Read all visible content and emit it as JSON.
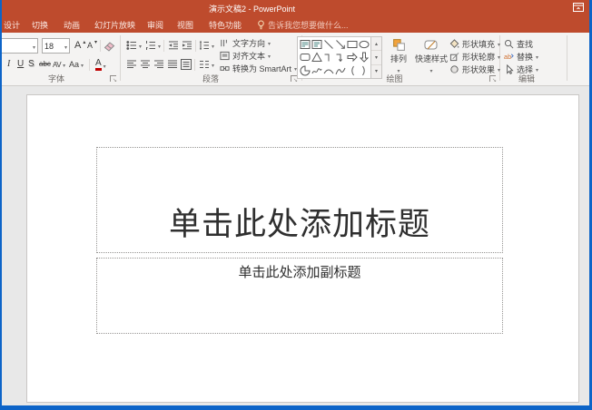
{
  "window": {
    "title": "演示文稿2 - PowerPoint"
  },
  "tabs": {
    "design": "设计",
    "transitions": "切换",
    "animations": "动画",
    "slideshow": "幻灯片放映",
    "review": "审阅",
    "view": "视图",
    "special_features": "特色功能",
    "tell_me": "告诉我您想要做什么..."
  },
  "font_group": {
    "label": "字体",
    "font_size": "18",
    "italic": "I",
    "underline": "U",
    "text_shadow": "S",
    "strikethrough": "abc",
    "char_spacing": "AV",
    "change_case": "Aa",
    "font_color": "A",
    "grow_font": "A",
    "shrink_font": "A"
  },
  "paragraph_group": {
    "label": "段落",
    "text_direction": "文字方向",
    "align_text": "对齐文本",
    "convert_smartart": "转换为 SmartArt"
  },
  "drawing_group": {
    "label": "绘图",
    "arrange": "排列",
    "quick_styles": "快速样式",
    "shape_fill": "形状填充",
    "shape_outline": "形状轮廓",
    "shape_effects": "形状效果"
  },
  "editing_group": {
    "label": "编辑",
    "find": "查找",
    "replace": "替换",
    "select": "选择"
  },
  "slide": {
    "title_placeholder": "单击此处添加标题",
    "subtitle_placeholder": "单击此处添加副标题"
  },
  "colors": {
    "titlebar": "#BE4B2D",
    "window_border": "#0D64C8",
    "ribbon_bg": "#F4F3F2",
    "workspace_bg": "#E8E8E8",
    "arrange_orange": "#F2A33C"
  }
}
